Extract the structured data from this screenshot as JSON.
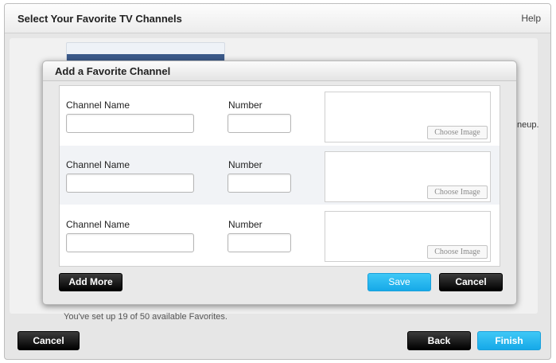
{
  "window": {
    "title": "Select Your Favorite TV Channels",
    "help_label": "Help"
  },
  "background": {
    "lineup_fragment": "neup.",
    "status_text": "You've set up 19 of 50 available Favorites.",
    "cancel_label": "Cancel",
    "back_label": "Back",
    "finish_label": "Finish"
  },
  "modal": {
    "title": "Add a Favorite Channel",
    "rows": [
      {
        "name_label": "Channel Name",
        "number_label": "Number",
        "name_value": "",
        "number_value": "",
        "choose_image_label": "Choose Image"
      },
      {
        "name_label": "Channel Name",
        "number_label": "Number",
        "name_value": "",
        "number_value": "",
        "choose_image_label": "Choose Image"
      },
      {
        "name_label": "Channel Name",
        "number_label": "Number",
        "name_value": "",
        "number_value": "",
        "choose_image_label": "Choose Image"
      }
    ],
    "add_more_label": "Add More",
    "save_label": "Save",
    "cancel_label": "Cancel"
  },
  "colors": {
    "accent_blue": "#1ab0ec",
    "button_black": "#111111"
  }
}
